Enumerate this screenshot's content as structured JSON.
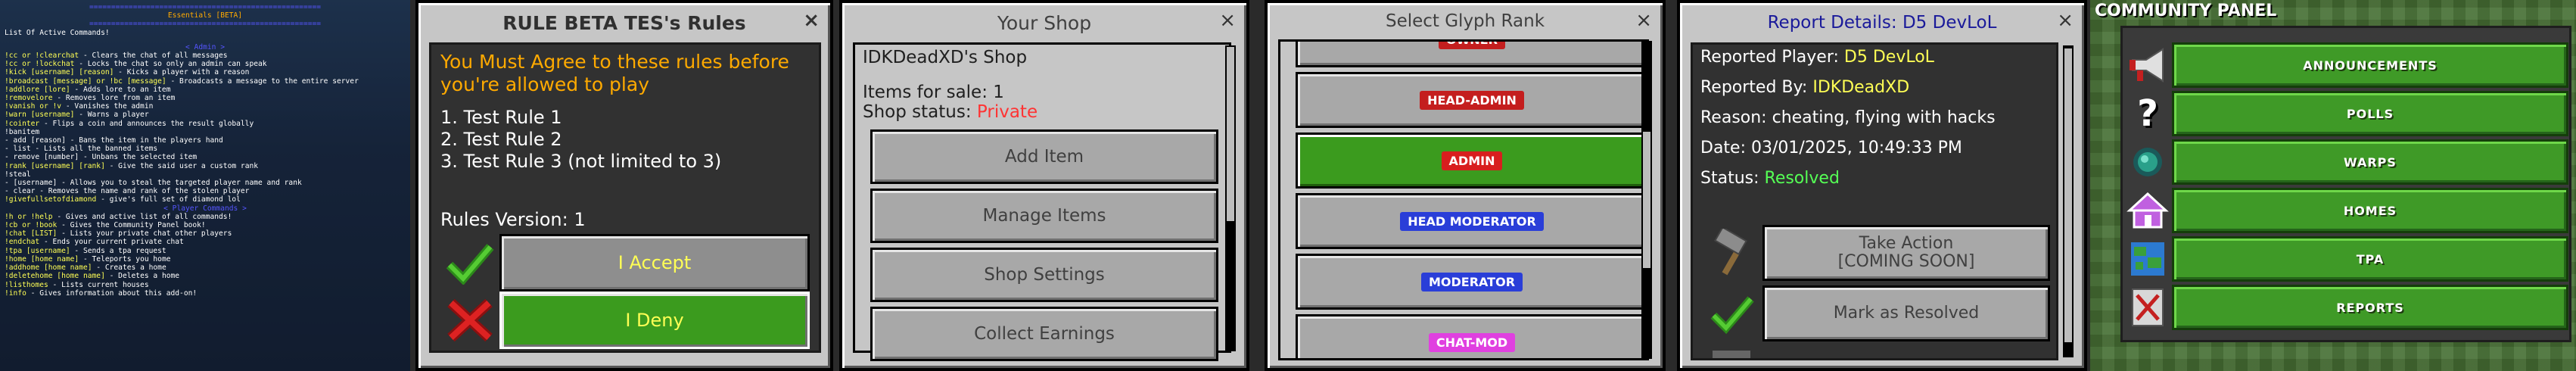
{
  "chat": {
    "title": "Essentials [BETA]",
    "intro": "List Of Active Commands!",
    "separator": "=====================================================",
    "admin_header": "< Admin >",
    "admin_lines": [
      "!cc or !clearchat  - Clears the chat of all messages",
      "!cc or !lockchat  - Locks the chat so only an admin can speak",
      "!kick [username] [reason]  - Kicks a player with a reason",
      "!broadcast [message] or !bc [message]  - Broadcasts a message to the entire server",
      "!addlore [lore]  - Adds lore to an item",
      "!removelore  - Removes lore from an item",
      "!vanish or !v  - Vanishes the admin",
      "!warn [username]  - Warns a player",
      "!cointer  - Flips a coin and announces the result globally",
      "!banitem",
      "  - add [reason]  - Bans the item in the players hand",
      "  - list  - Lists all the banned items",
      "  - remove [number]  - Unbans the selected item",
      "!rank [username] [rank]  - Give the said user a custom rank",
      "!steal",
      "  - [username]  - Allows you to steal the targeted player name and rank",
      "  - clear  - Removes the name and rank of the stolen player",
      "!givefullsetofdiamond  - give's full set of diamond lol"
    ],
    "player_header": "< Player Commands >",
    "player_lines": [
      "!h or !help  - Gives and active list of all commands!",
      "!cb or !book  - Gives the Community Panel book!",
      "!chat [LIST]  - Lists your private chat other players",
      "!endchat  - Ends your current private chat",
      "!tpa [username]  - Sends a tpa request",
      "!home [home name]  - Teleports you home",
      "!addhome [home name]  - Creates a home",
      "!deletehome [home name]  - Deletes a home",
      "!listhomes  - Lists current houses",
      "!info  - Gives information about this add-on!"
    ]
  },
  "rules": {
    "title": "RULE BETA TES's Rules",
    "close": "×",
    "warning": "You Must Agree to these rules before you're allowed to play",
    "items": [
      "1. Test Rule 1",
      "2. Test Rule 2",
      "3. Test Rule 3 (not limited to 3)"
    ],
    "version": "Rules Version: 1",
    "accept_label": "I Accept",
    "deny_label": "I Deny"
  },
  "shop": {
    "title": "Your Shop",
    "close": "×",
    "owner": "IDKDeadXD's Shop",
    "items_for_sale": "Items for sale: 1",
    "status_label": "Shop status: ",
    "status_value": "Private",
    "buttons": [
      "Add Item",
      "Manage Items",
      "Shop Settings",
      "Collect Earnings"
    ]
  },
  "glyph": {
    "title": "Select Glyph Rank",
    "close": "×",
    "ranks": [
      {
        "label": "OWNER",
        "bg": "#c41e1e",
        "fg": "#ffffff",
        "selected": false
      },
      {
        "label": "HEAD-ADMIN",
        "bg": "#c41e1e",
        "fg": "#ffffff",
        "selected": false
      },
      {
        "label": "ADMIN",
        "bg": "#d81e1e",
        "fg": "#ffffff",
        "selected": true
      },
      {
        "label": "HEAD MODERATOR",
        "bg": "#2a3ed8",
        "fg": "#ffffff",
        "selected": false
      },
      {
        "label": "MODERATOR",
        "bg": "#2a3ed8",
        "fg": "#ffffff",
        "selected": false
      },
      {
        "label": "CHAT-MOD",
        "bg": "#e040e0",
        "fg": "#ffffff",
        "selected": false
      }
    ]
  },
  "report": {
    "title": "Report Details: D5 DevLoL",
    "close": "×",
    "reported_player_label": "Reported Player: ",
    "reported_player": "D5 DevLoL",
    "reported_by_label": "Reported By: ",
    "reported_by": "IDKDeadXD",
    "reason_label": "Reason: ",
    "reason": "cheating, flying with hacks",
    "date_label": "Date: ",
    "date": "03/01/2025, 10:49:33 PM",
    "status_label": "Status: ",
    "status": "Resolved",
    "take_action_line1": "Take Action",
    "take_action_line2": "[COMING SOON]",
    "resolve_label": "Mark as Resolved"
  },
  "community": {
    "title": "COMMUNITY PANEL",
    "items": [
      {
        "label": "ANNOUNCEMENTS",
        "icon": "megaphone-icon"
      },
      {
        "label": "POLLS",
        "icon": "question-mark-icon"
      },
      {
        "label": "WARPS",
        "icon": "ender-pearl-icon"
      },
      {
        "label": "HOMES",
        "icon": "house-icon"
      },
      {
        "label": "TPA",
        "icon": "globe-icon"
      },
      {
        "label": "REPORTS",
        "icon": "report-icon"
      }
    ]
  }
}
